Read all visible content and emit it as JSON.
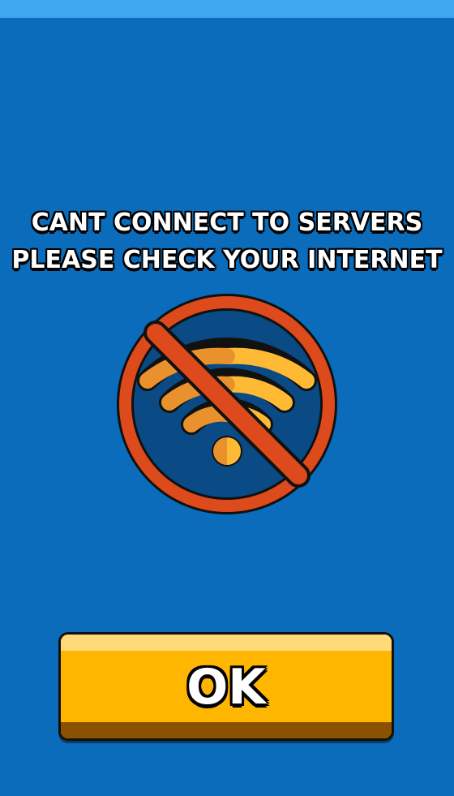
{
  "dialog": {
    "message_line1": "CANT CONNECT TO SERVERS",
    "message_line2": "PLEASE CHECK YOUR INTERNET",
    "icon": "no-wifi-icon",
    "ok_label": "OK"
  },
  "colors": {
    "background": "#0a6cba",
    "top_strip": "#3fa6f0",
    "prohibit_ring": "#dd4a1b",
    "icon_inner": "#0a4a85",
    "wifi_light": "#ffba35",
    "wifi_dark": "#e9912c",
    "button_face": "#ffb600",
    "button_highlight": "#ffd97a",
    "button_shadow": "#8a5200"
  }
}
